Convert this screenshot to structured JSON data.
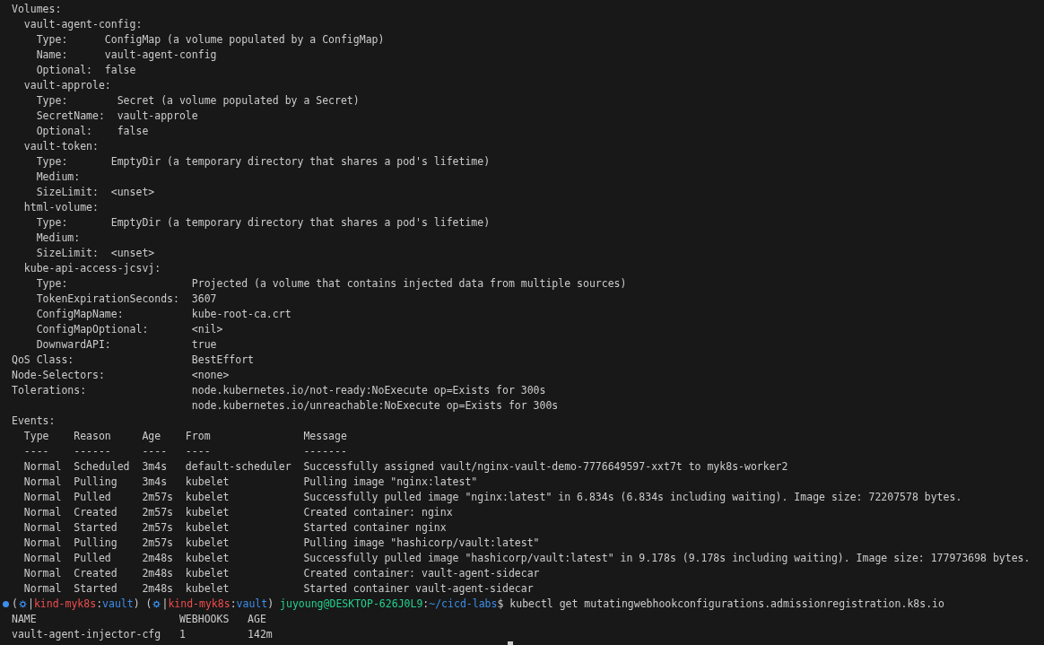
{
  "output": [
    "Volumes:",
    "  vault-agent-config:",
    "    Type:      ConfigMap (a volume populated by a ConfigMap)",
    "    Name:      vault-agent-config",
    "    Optional:  false",
    "  vault-approle:",
    "    Type:        Secret (a volume populated by a Secret)",
    "    SecretName:  vault-approle",
    "    Optional:    false",
    "  vault-token:",
    "    Type:       EmptyDir (a temporary directory that shares a pod's lifetime)",
    "    Medium:",
    "    SizeLimit:  <unset>",
    "  html-volume:",
    "    Type:       EmptyDir (a temporary directory that shares a pod's lifetime)",
    "    Medium:",
    "    SizeLimit:  <unset>",
    "  kube-api-access-jcsvj:",
    "    Type:                    Projected (a volume that contains injected data from multiple sources)",
    "    TokenExpirationSeconds:  3607",
    "    ConfigMapName:           kube-root-ca.crt",
    "    ConfigMapOptional:       <nil>",
    "    DownwardAPI:             true",
    "QoS Class:                   BestEffort",
    "Node-Selectors:              <none>",
    "Tolerations:                 node.kubernetes.io/not-ready:NoExecute op=Exists for 300s",
    "                             node.kubernetes.io/unreachable:NoExecute op=Exists for 300s",
    "Events:",
    "  Type    Reason     Age    From               Message",
    "  ----    ------     ----   ----               -------",
    "  Normal  Scheduled  3m4s   default-scheduler  Successfully assigned vault/nginx-vault-demo-7776649597-xxt7t to myk8s-worker2",
    "  Normal  Pulling    3m4s   kubelet            Pulling image \"nginx:latest\"",
    "  Normal  Pulled     2m57s  kubelet            Successfully pulled image \"nginx:latest\" in 6.834s (6.834s including waiting). Image size: 72207578 bytes.",
    "  Normal  Created    2m57s  kubelet            Created container: nginx",
    "  Normal  Started    2m57s  kubelet            Started container nginx",
    "  Normal  Pulling    2m57s  kubelet            Pulling image \"hashicorp/vault:latest\"",
    "  Normal  Pulled     2m48s  kubelet            Successfully pulled image \"hashicorp/vault:latest\" in 9.178s (9.178s including waiting). Image size: 177973698 bytes.",
    "  Normal  Created    2m48s  kubelet            Created container: vault-agent-sidecar",
    "  Normal  Started    2m48s  kubelet            Started container vault-agent-sidecar"
  ],
  "prompt": [
    {
      "kind": "text",
      "text": "("
    },
    {
      "kind": "icon"
    },
    {
      "kind": "text",
      "text": "|"
    },
    {
      "kind": "text",
      "text": "kind-myk8s",
      "color": "#f14c4c"
    },
    {
      "kind": "text",
      "text": ":"
    },
    {
      "kind": "text",
      "text": "vault",
      "color": "#3b8eea"
    },
    {
      "kind": "text",
      "text": ") ("
    },
    {
      "kind": "icon"
    },
    {
      "kind": "text",
      "text": "|"
    },
    {
      "kind": "text",
      "text": "kind-myk8s",
      "color": "#f14c4c"
    },
    {
      "kind": "text",
      "text": ":"
    },
    {
      "kind": "text",
      "text": "vault",
      "color": "#3b8eea"
    },
    {
      "kind": "text",
      "text": ") "
    },
    {
      "kind": "text",
      "text": "juyoung@DESKTOP-626J0L9",
      "color": "#23d18b"
    },
    {
      "kind": "text",
      "text": ":"
    },
    {
      "kind": "text",
      "text": "~/cicd-labs",
      "color": "#3b8eea"
    },
    {
      "kind": "text",
      "text": "$ kubectl get mutatingwebhookconfigurations.admissionregistration.k8s.io",
      "color": "#cccccc"
    }
  ],
  "result": [
    "NAME                       WEBHOOKS   AGE",
    "vault-agent-injector-cfg   1          142m"
  ]
}
